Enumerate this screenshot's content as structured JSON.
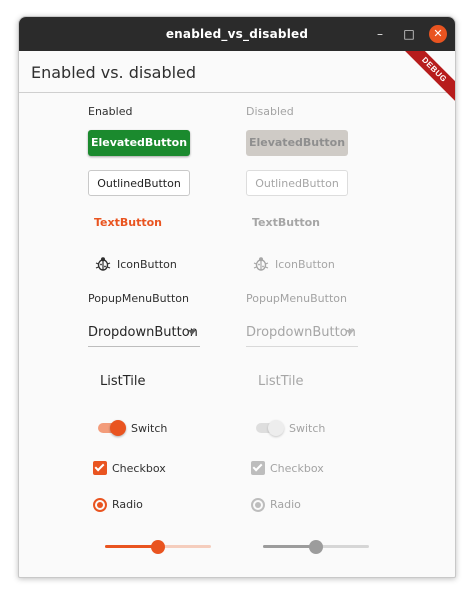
{
  "window": {
    "title": "enabled_vs_disabled",
    "min_glyph": "–",
    "max_glyph": "□",
    "close_glyph": "✕"
  },
  "appbar": {
    "title": "Enabled vs. disabled",
    "debug_banner": "DEBUG"
  },
  "columns": {
    "enabled": "Enabled",
    "disabled": "Disabled"
  },
  "widgets": {
    "elevated": "ElevatedButton",
    "outlined": "OutlinedButton",
    "text": "TextButton",
    "icon": "IconButton",
    "popup": "PopupMenuButton",
    "dropdown": "DropdownButton",
    "listtile": "ListTile",
    "switch": "Switch",
    "checkbox": "Checkbox",
    "radio": "Radio"
  },
  "state": {
    "switch_on": true,
    "checkbox_checked": true,
    "radio_selected": true,
    "slider_value_enabled": 0.5,
    "slider_value_disabled": 0.5
  },
  "icons": {
    "icon_button": "bug-icon"
  },
  "colors": {
    "accent": "#e95420",
    "elevated": "#1b8a2e",
    "disabled": "#a6a6a6"
  }
}
